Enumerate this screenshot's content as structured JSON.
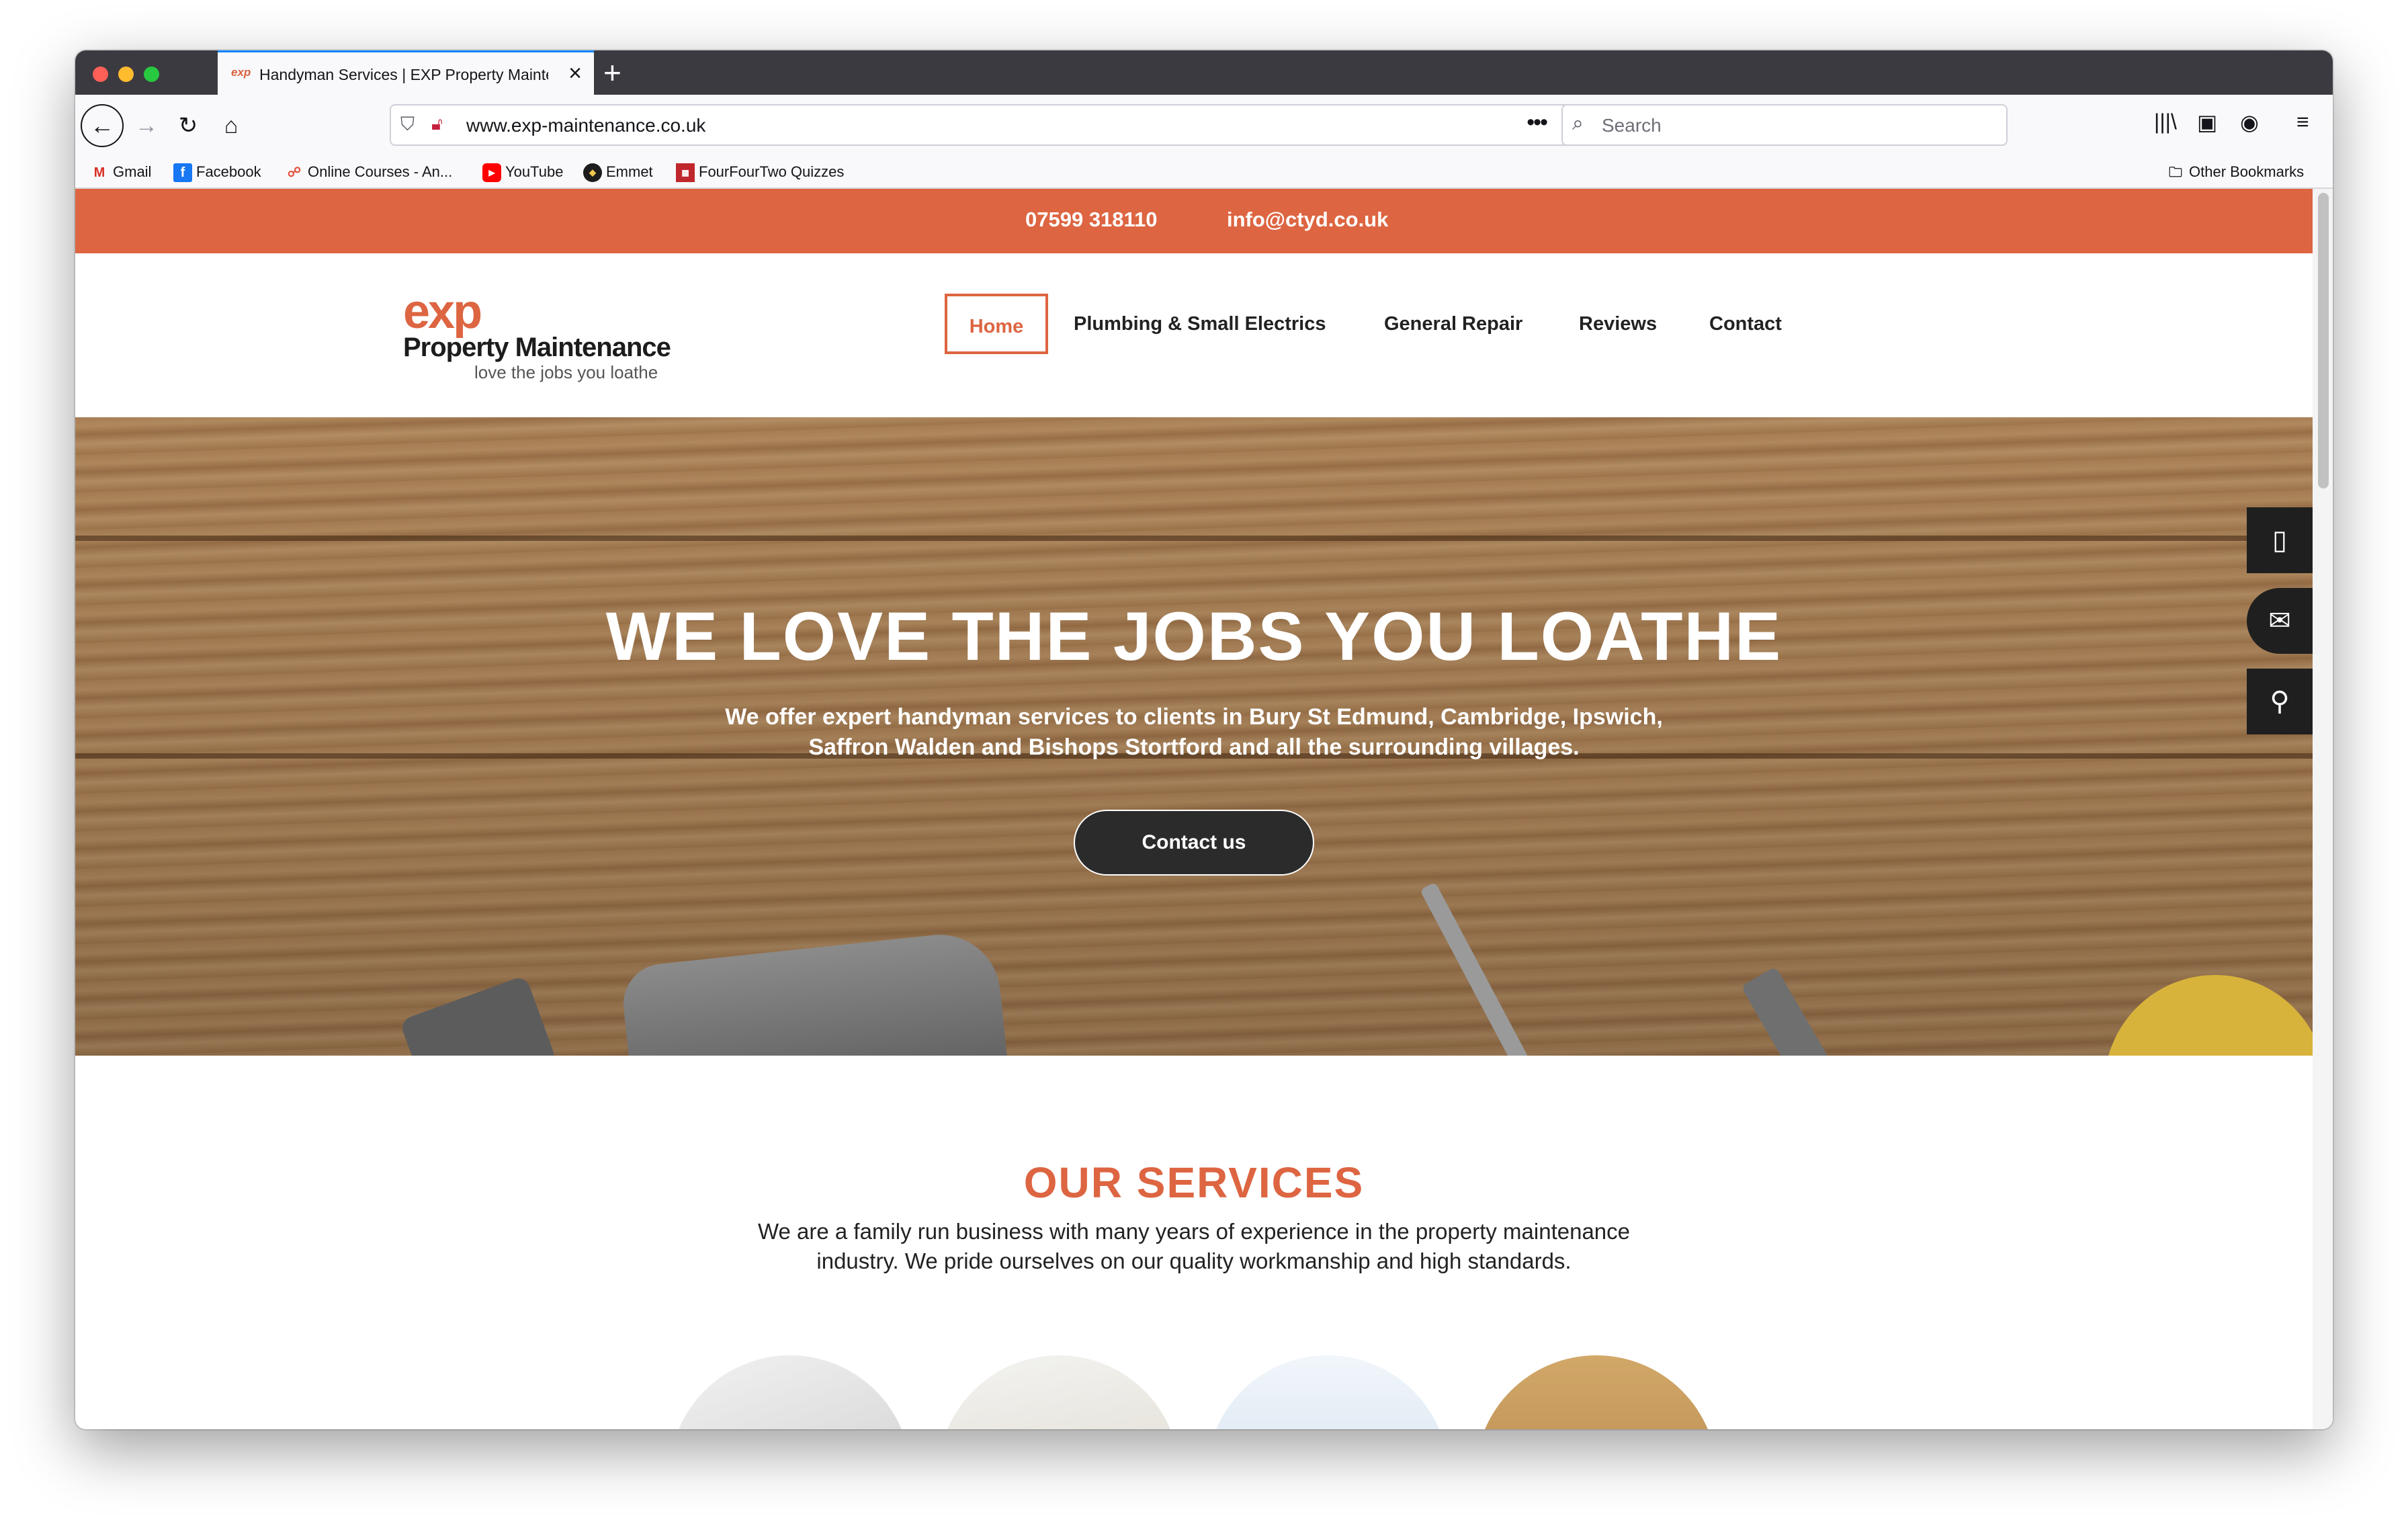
{
  "browser": {
    "tab_title": "Handyman Services | EXP Property Maintenance",
    "tab_favicon": "exp",
    "url": "www.exp-maintenance.co.uk",
    "search_placeholder": "Search",
    "bookmarks": [
      "Gmail",
      "Facebook",
      "Online Courses - An...",
      "YouTube",
      "Emmet",
      "FourFourTwo Quizzes"
    ],
    "other_bookmarks": "Other Bookmarks"
  },
  "site": {
    "phone": "07599 318110",
    "email": "info@ctyd.co.uk",
    "logo": {
      "brand": "exp",
      "name": "Property Maintenance",
      "tagline": "love the jobs you loathe"
    },
    "nav": [
      "Home",
      "Plumbing & Small Electrics",
      "General Repair",
      "Reviews",
      "Contact"
    ],
    "active_nav": "Home",
    "hero": {
      "title": "WE LOVE THE JOBS YOU LOATHE",
      "subtitle": "We offer expert handyman services to clients in Bury St Edmund, Cambridge, Ipswich, Saffron Walden and Bishops Stortford and all the surrounding villages.",
      "button": "Contact us"
    },
    "services": {
      "title": "OUR SERVICES",
      "text": "We are a family run business with many years of experience in the property maintenance industry. We pride ourselves on our quality workmanship and high standards."
    },
    "side_buttons": [
      "phone-icon",
      "envelope-icon",
      "map-pin-icon"
    ]
  },
  "colors": {
    "brand_orange": "#dd6541",
    "dark": "#2b2b2b"
  }
}
